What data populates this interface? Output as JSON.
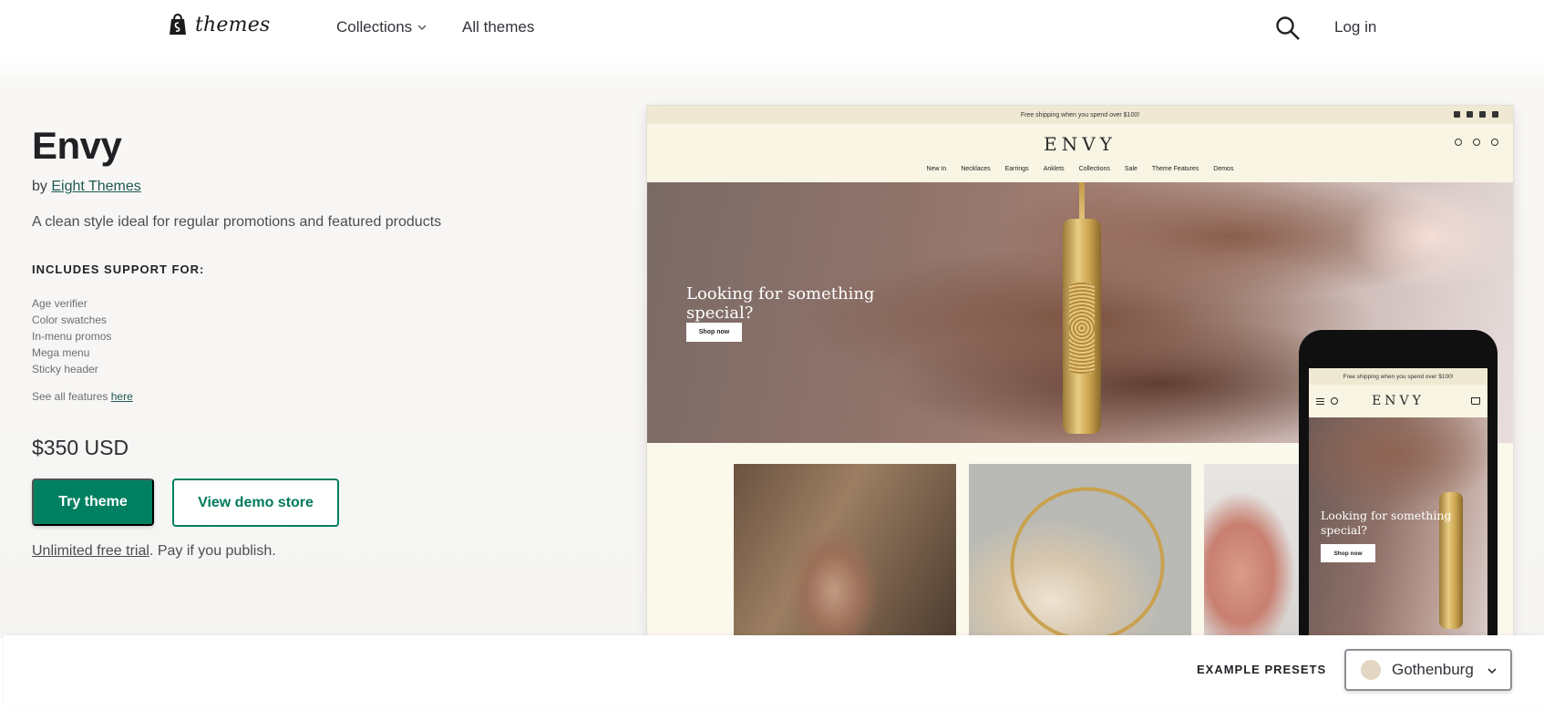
{
  "nav": {
    "brand": "themes",
    "collections": "Collections",
    "all_themes": "All themes",
    "log_in": "Log in"
  },
  "theme": {
    "title": "Envy",
    "by_prefix": "by",
    "author": "Eight Themes",
    "tagline": "A clean style ideal for regular promotions and featured products",
    "support_heading": "INCLUDES SUPPORT FOR:",
    "features": [
      "Age verifier",
      "Color swatches",
      "In-menu promos",
      "Mega menu",
      "Sticky header"
    ],
    "see_all_prefix": "See all features",
    "see_all_link": "here",
    "price": "$350 USD",
    "try_button": "Try theme",
    "demo_button": "View demo store",
    "trial_link": "Unlimited free trial",
    "trial_suffix": ". Pay if you publish."
  },
  "preview": {
    "shipping_banner": "Free shipping when you spend over $100!",
    "store_logo": "ENVY",
    "menu": [
      "New In",
      "Necklaces",
      "Earrings",
      "Anklets",
      "Collections",
      "Sale",
      "Theme Features",
      "Demos"
    ],
    "hero_text": "Looking for something special?",
    "shop_button": "Shop now",
    "cart_count": "0"
  },
  "presets": {
    "label": "EXAMPLE PRESETS",
    "selected": "Gothenburg",
    "swatch_color": "#e3d6c2"
  },
  "colors": {
    "accent": "#008060",
    "author_link": "#1d5a54"
  }
}
